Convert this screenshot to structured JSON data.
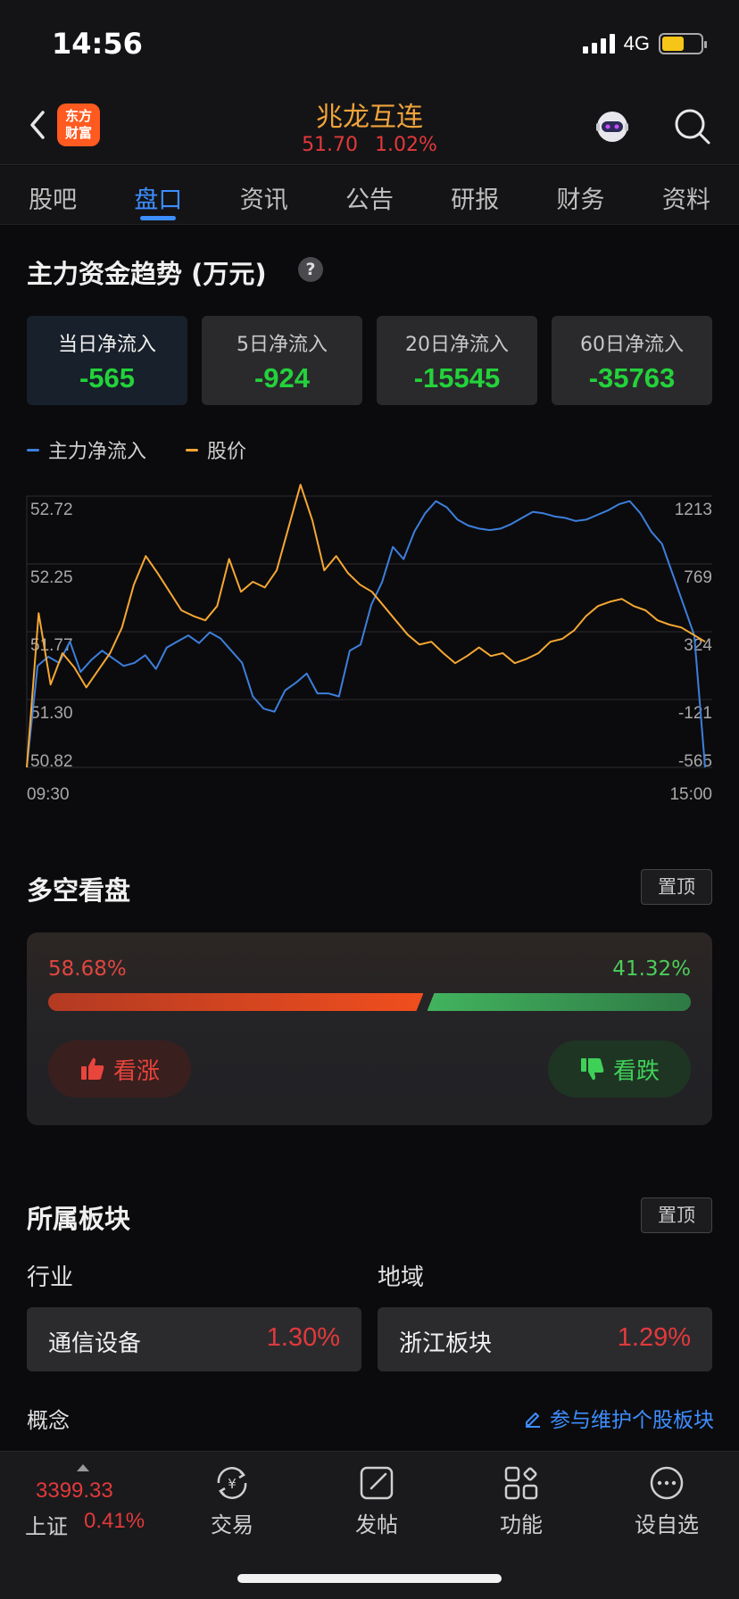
{
  "status_bar": {
    "time": "14:56",
    "network": "4G"
  },
  "header": {
    "logo_text": "东方\n财富",
    "title": "兆龙互连",
    "price": "51.70",
    "change_pct": "1.02%"
  },
  "tabs": [
    "股吧",
    "盘口",
    "资讯",
    "公告",
    "研报",
    "财务",
    "资料"
  ],
  "active_tab": 1,
  "fund_flow": {
    "title": "主力资金趋势 (万元)",
    "help": "?",
    "cards": [
      {
        "label": "当日净流入",
        "value": "-565"
      },
      {
        "label": "5日净流入",
        "value": "-924"
      },
      {
        "label": "20日净流入",
        "value": "-15545"
      },
      {
        "label": "60日净流入",
        "value": "-35763"
      }
    ],
    "legend": [
      {
        "name": "主力净流入",
        "color": "#3d7fdc"
      },
      {
        "name": "股价",
        "color": "#f5a733"
      }
    ]
  },
  "chart_data": {
    "type": "line",
    "x_start": "09:30",
    "x_end": "15:00",
    "left_ticks": [
      "52.72",
      "52.25",
      "51.77",
      "51.30",
      "50.82"
    ],
    "right_ticks": [
      "1213",
      "769",
      "324",
      "-121",
      "-565"
    ],
    "ylim_left": [
      50.82,
      52.72
    ],
    "ylim_right": [
      -565,
      1213
    ],
    "series": [
      {
        "name": "主力净流入",
        "color": "#3d7fdc",
        "values": [
          -565,
          100,
          160,
          120,
          260,
          60,
          140,
          200,
          150,
          100,
          120,
          170,
          80,
          220,
          260,
          300,
          250,
          320,
          280,
          200,
          120,
          -100,
          -180,
          -200,
          -60,
          -10,
          50,
          -80,
          -80,
          -100,
          200,
          240,
          500,
          650,
          880,
          800,
          980,
          1100,
          1180,
          1140,
          1060,
          1020,
          1000,
          990,
          1000,
          1030,
          1070,
          1110,
          1100,
          1080,
          1070,
          1050,
          1060,
          1090,
          1120,
          1160,
          1180,
          1100,
          980,
          900,
          700,
          500,
          300,
          -565
        ]
      },
      {
        "name": "股价",
        "color": "#f5a733",
        "values": [
          50.82,
          51.9,
          51.4,
          51.62,
          51.52,
          51.38,
          51.5,
          51.62,
          51.8,
          52.1,
          52.3,
          52.18,
          52.05,
          51.92,
          51.88,
          51.85,
          51.95,
          52.28,
          52.05,
          52.12,
          52.08,
          52.2,
          52.5,
          52.8,
          52.55,
          52.2,
          52.3,
          52.18,
          52.1,
          52.05,
          51.95,
          51.85,
          51.75,
          51.68,
          51.7,
          51.62,
          51.55,
          51.6,
          51.66,
          51.6,
          51.62,
          51.55,
          51.58,
          51.62,
          51.7,
          51.72,
          51.78,
          51.88,
          51.95,
          51.98,
          52.0,
          51.95,
          51.92,
          51.85,
          51.82,
          51.8,
          51.75,
          51.7
        ]
      }
    ]
  },
  "long_short": {
    "title": "多空看盘",
    "pin_label": "置顶",
    "bull_pct": "58.68%",
    "bear_pct": "41.32%",
    "bull_ratio": 0.5868,
    "bull_label": "看涨",
    "bear_label": "看跌"
  },
  "sectors": {
    "title": "所属板块",
    "pin_label": "置顶",
    "industry_label": "行业",
    "region_label": "地域",
    "industry": {
      "name": "通信设备",
      "pct": "1.30%"
    },
    "region": {
      "name": "浙江板块",
      "pct": "1.29%"
    },
    "concept_label": "概念",
    "maintain_link": "参与维护个股板块"
  },
  "bottom_bar": {
    "index_value": "3399.33",
    "index_name": "上证",
    "index_pct": "0.41%",
    "items": [
      "交易",
      "发帖",
      "功能",
      "设自选"
    ]
  }
}
